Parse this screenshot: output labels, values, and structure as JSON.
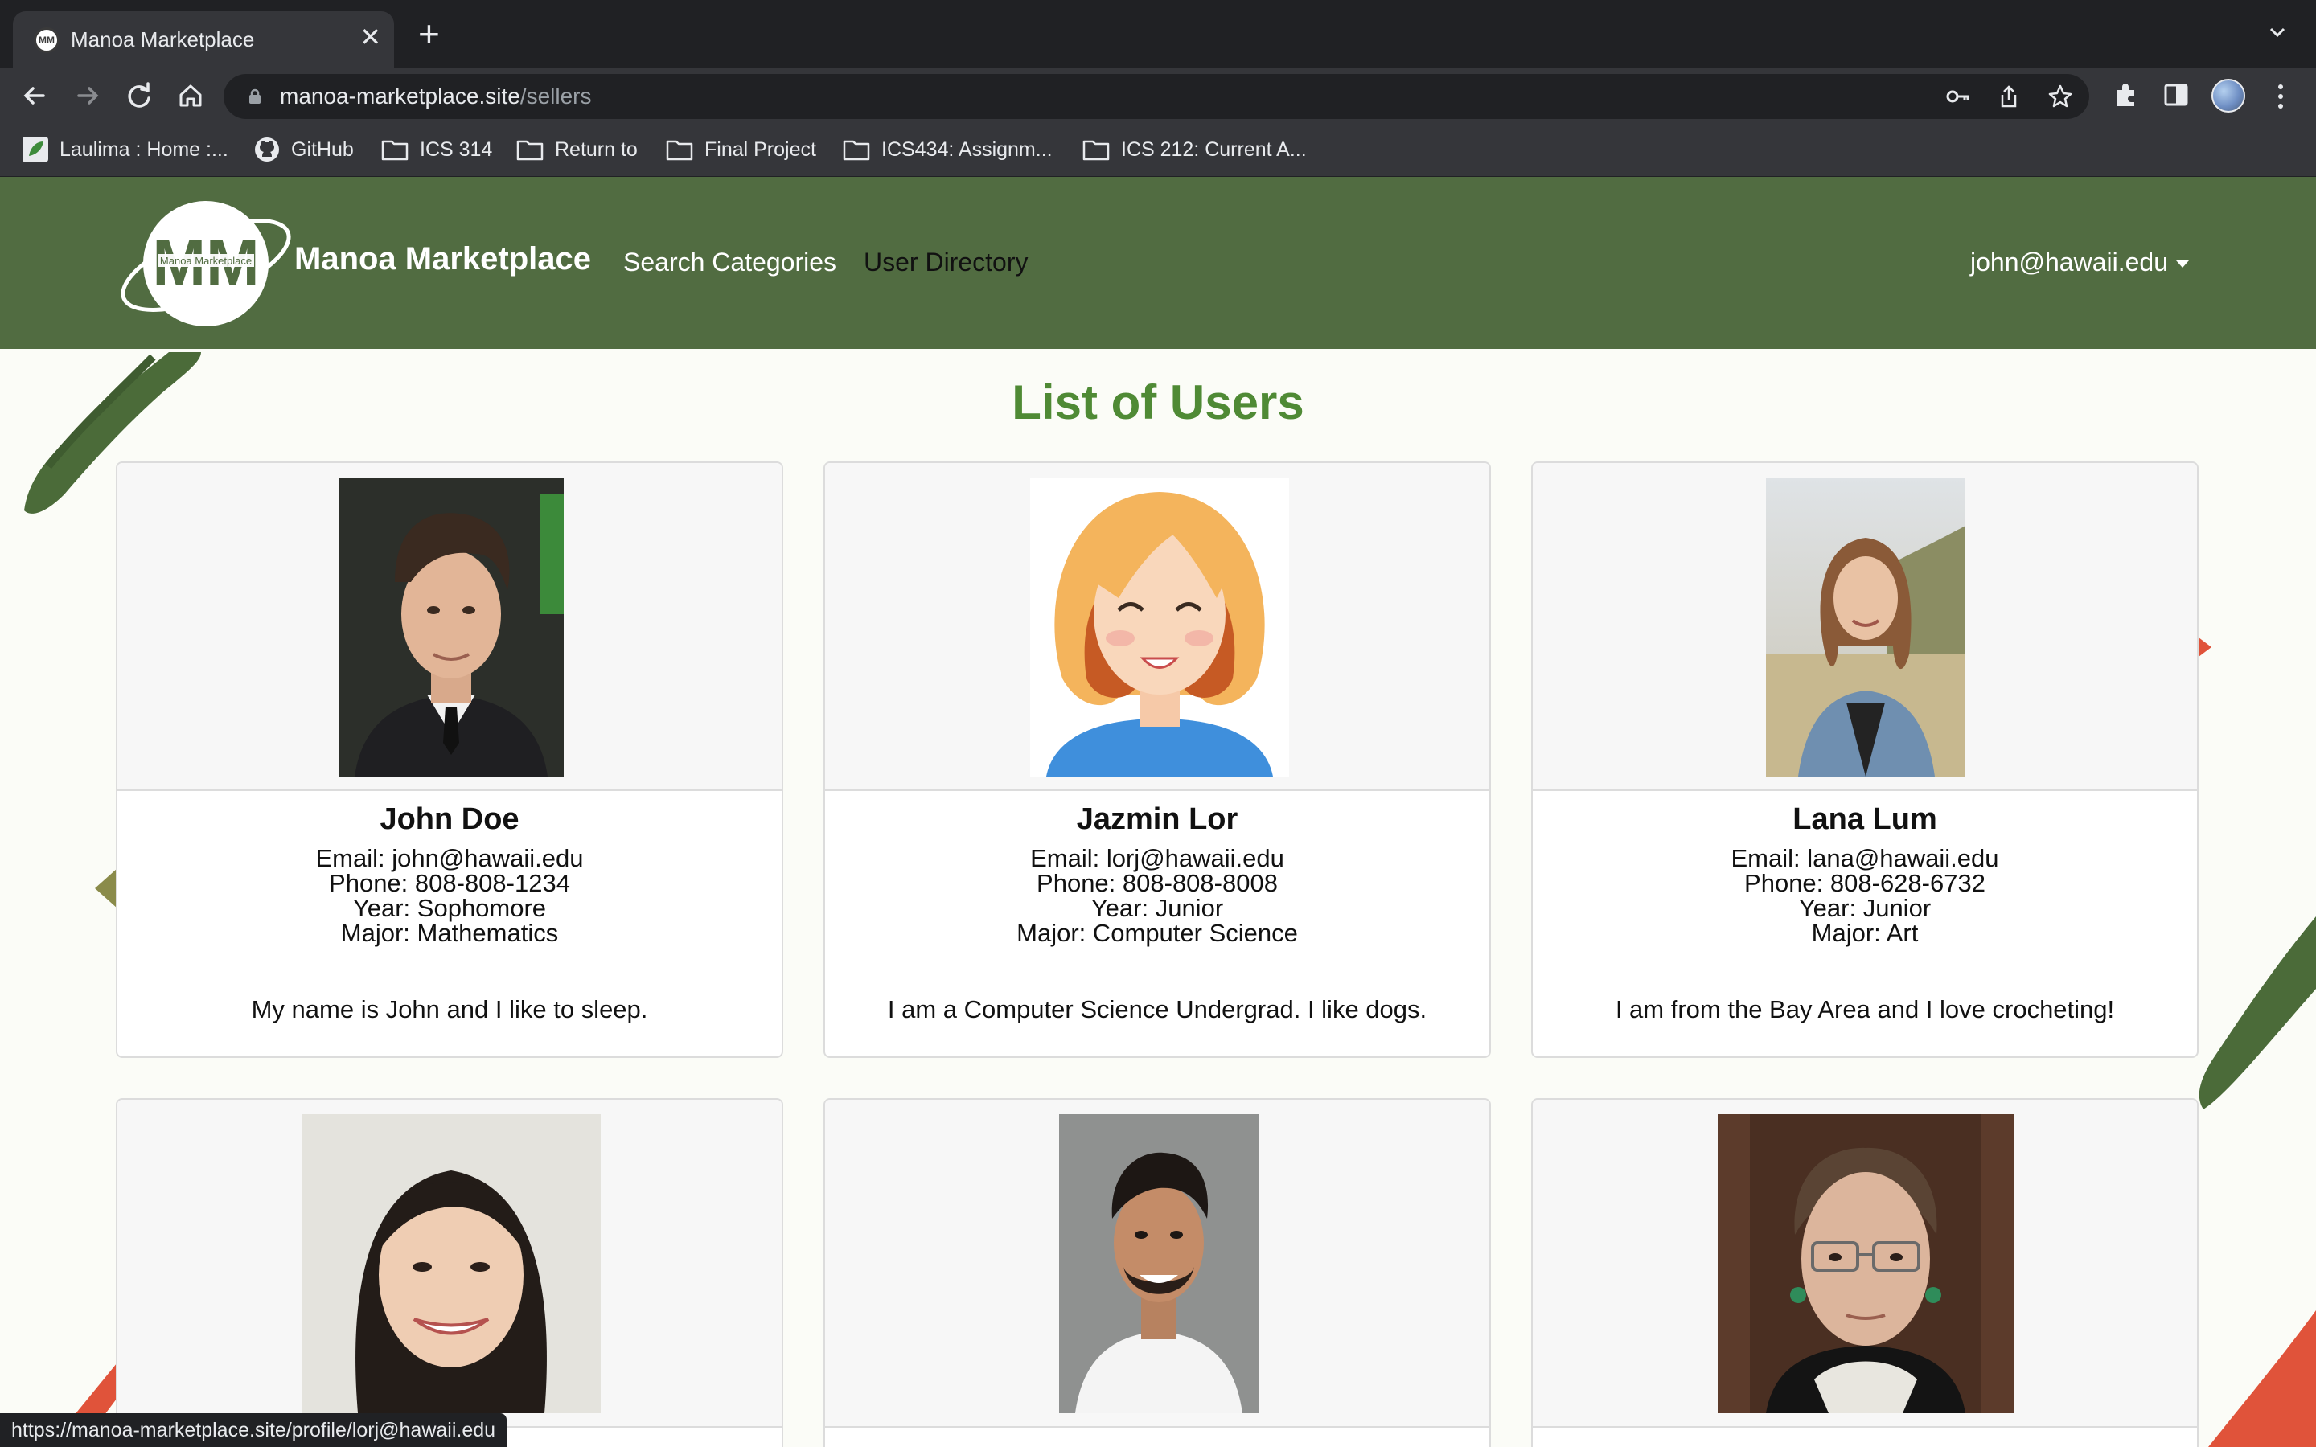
{
  "browser": {
    "tab_title": "Manoa Marketplace",
    "url_host": "manoa-marketplace.site",
    "url_path": "/sellers",
    "bookmarks": [
      {
        "label": "Laulima : Home :...",
        "icon": "laulima-icon"
      },
      {
        "label": "GitHub",
        "icon": "github-icon"
      },
      {
        "label": "ICS 314",
        "icon": "folder-icon"
      },
      {
        "label": "Return to",
        "icon": "folder-icon"
      },
      {
        "label": "Final Project",
        "icon": "folder-icon"
      },
      {
        "label": "ICS434: Assignm...",
        "icon": "folder-icon"
      },
      {
        "label": "ICS 212: Current A...",
        "icon": "folder-icon"
      }
    ],
    "status_url": "https://manoa-marketplace.site/profile/lorj@hawaii.edu"
  },
  "site": {
    "logo_text": "Manoa Marketplace",
    "logo_initials": "MM",
    "brand": "Manoa Marketplace",
    "nav": [
      {
        "label": "Search Categories"
      },
      {
        "label": "User Directory"
      }
    ],
    "user_email": "john@hawaii.edu",
    "colors": {
      "navbar": "#516c41",
      "title": "#4f8a35",
      "accent_red": "#e0533a"
    }
  },
  "main": {
    "title": "List of Users",
    "users": [
      {
        "name": "John Doe",
        "email": "Email: john@hawaii.edu",
        "phone": "Phone: 808-808-1234",
        "year": "Year: Sophomore",
        "major": "Major: Mathematics",
        "bio": "My name is John and I like to sleep.",
        "photo": "man-in-suit-photo"
      },
      {
        "name": "Jazmin Lor",
        "email": "Email: lorj@hawaii.edu",
        "phone": "Phone: 808-808-8008",
        "year": "Year: Junior",
        "major": "Major: Computer Science",
        "bio": "I am a Computer Science Undergrad. I like dogs.",
        "photo": "cartoon-woman-avatar"
      },
      {
        "name": "Lana Lum",
        "email": "Email: lana@hawaii.edu",
        "phone": "Phone: 808-628-6732",
        "year": "Year: Junior",
        "major": "Major: Art",
        "bio": "I am from the Bay Area and I love crocheting!",
        "photo": "woman-in-field-photo"
      },
      {
        "photo": "smiling-woman-photo"
      },
      {
        "photo": "smiling-man-photo"
      },
      {
        "photo": "older-woman-photo"
      }
    ]
  }
}
